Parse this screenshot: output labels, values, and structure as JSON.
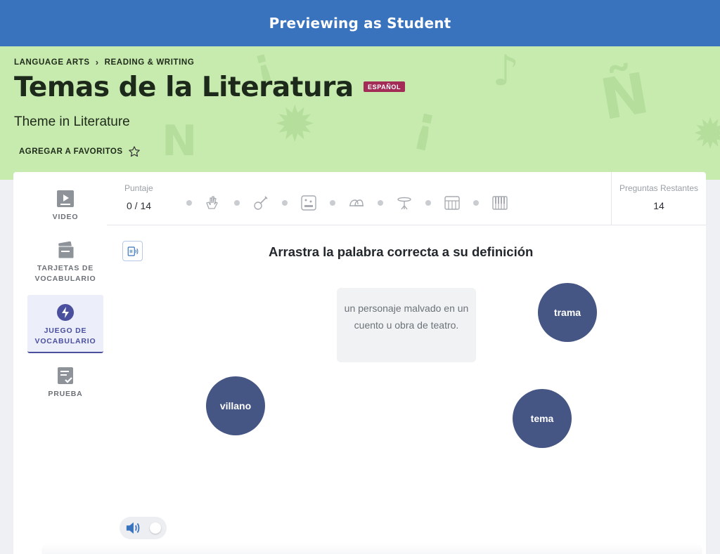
{
  "preview_banner": {
    "text": "Previewing as Student"
  },
  "breadcrumb": {
    "items": [
      "LANGUAGE ARTS",
      "READING & WRITING"
    ],
    "separator": "›"
  },
  "lesson": {
    "title": "Temas de la Literatura",
    "language_badge": "ESPAÑOL",
    "subtitle": "Theme in Literature",
    "favorite_label": "AGREGAR A FAVORITOS"
  },
  "sidebar": {
    "items": [
      {
        "label": "VIDEO",
        "icon": "play-icon",
        "active": false
      },
      {
        "label": "TARJETAS DE VOCABULARIO",
        "icon": "flashcards-icon",
        "active": false
      },
      {
        "label": "JUEGO DE VOCABULARIO",
        "icon": "lightning-icon",
        "active": true
      },
      {
        "label": "PRUEBA",
        "icon": "quiz-checklist-icon",
        "active": false
      }
    ]
  },
  "score": {
    "label": "Puntaje",
    "value": "0 / 14",
    "track_icons": [
      "clapping-hands-icon",
      "guitar-icon",
      "mixer-icon",
      "bells-icon",
      "cymbal-icon",
      "synthesizer-icon",
      "piano-keys-icon"
    ]
  },
  "remaining": {
    "label": "Preguntas Restantes",
    "value": "14"
  },
  "game": {
    "instruction": "Arrastra la palabra correcta a su definición",
    "definition": "un personaje malvado en un cuento u obra de teatro.",
    "words": [
      "trama",
      "villano",
      "tema"
    ]
  },
  "colors": {
    "banner": "#3a73bd",
    "hero": "#c7ebae",
    "badge": "#a22c55",
    "word_bubble": "#455584",
    "active_nav": "#4a4f9e"
  },
  "sound": {
    "enabled": true
  }
}
